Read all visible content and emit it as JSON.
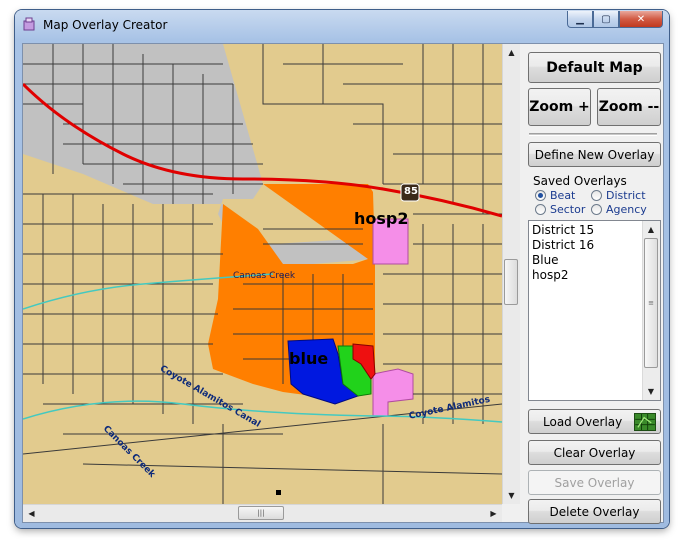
{
  "window": {
    "title": "Map Overlay Creator",
    "controls": [
      "minimize",
      "maximize",
      "close"
    ]
  },
  "map": {
    "labels": {
      "hosp2": "hosp2",
      "blue": "blue",
      "canoas_creek_1": "Canoas Creek",
      "canoas_creek_2": "Canoas Creek",
      "coyote_alamitos_canal": "Coyote Alamitos Canal",
      "coyote_alamitos_2": "Coyote Alamitos",
      "highway_shield": "85"
    },
    "colors": {
      "background": "#e2cb8e",
      "streets": "#3a3a3a",
      "highway": "#e00000",
      "creek": "#44c9c0",
      "gray_overlay": "#c1c1c1",
      "orange_overlay": "#ff7f00",
      "pink_overlay": "#f58ee8",
      "blue_overlay": "#0018e0",
      "green_overlay": "#21d21b",
      "red_overlay": "#ee1010"
    }
  },
  "panel": {
    "default_map": "Default Map",
    "zoom_in": "Zoom +",
    "zoom_out": "Zoom --",
    "define_new_overlay": "Define New Overlay",
    "saved_overlays_label": "Saved Overlays",
    "radio_options": [
      {
        "label": "Beat",
        "selected": true
      },
      {
        "label": "District",
        "selected": false
      },
      {
        "label": "Sector",
        "selected": false
      },
      {
        "label": "Agency",
        "selected": false
      }
    ],
    "overlay_list": [
      "District 15",
      "District 16",
      "Blue",
      "hosp2"
    ],
    "load_overlay": "Load Overlay",
    "clear_overlay": "Clear Overlay",
    "save_overlay": "Save Overlay",
    "delete_overlay": "Delete Overlay"
  }
}
